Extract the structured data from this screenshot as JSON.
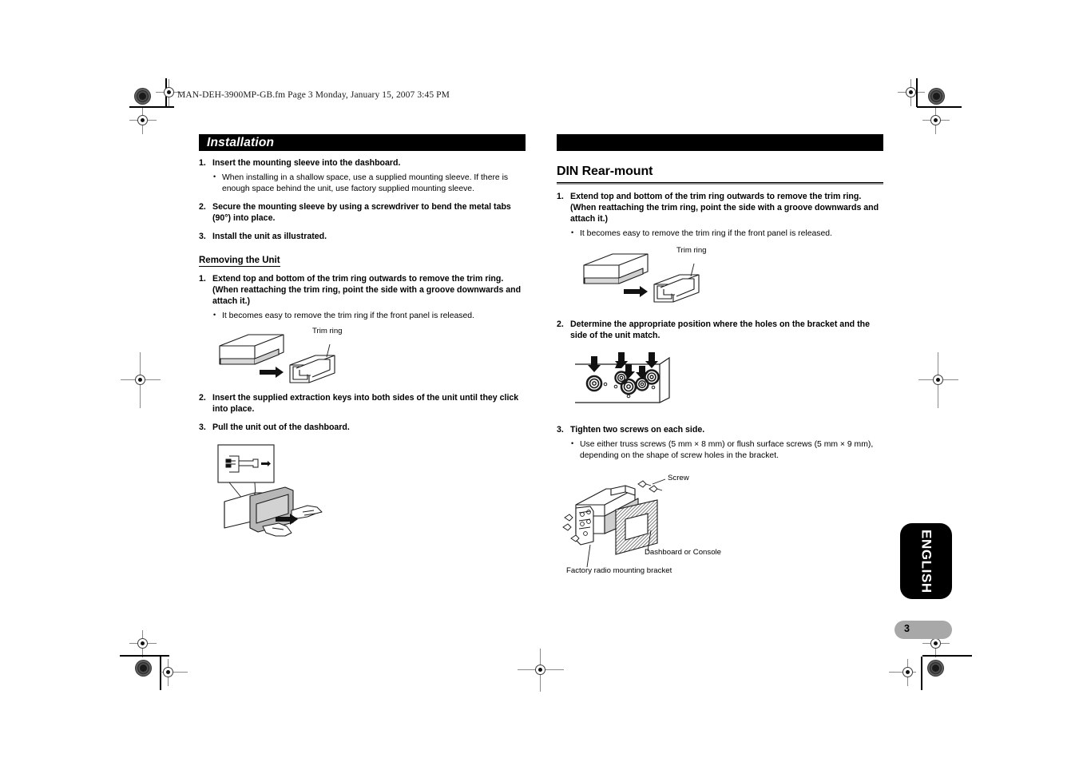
{
  "document": {
    "file_header": "MAN-DEH-3900MP-GB.fm  Page 3  Monday, January 15, 2007  3:45 PM",
    "page_number": "3",
    "language_tab": "ENGLISH"
  },
  "left_column": {
    "bar_title": "Installation",
    "steps": [
      {
        "num": "1.",
        "text": "Insert the mounting sleeve into the dashboard.",
        "bullets": [
          "When installing in a shallow space, use a supplied mounting sleeve. If there is enough space behind the unit, use factory supplied mounting sleeve."
        ]
      },
      {
        "num": "2.",
        "text": "Secure the mounting sleeve by using a screwdriver to bend the metal tabs (90°) into place.",
        "bullets": []
      },
      {
        "num": "3.",
        "text": "Install the unit as illustrated.",
        "bullets": []
      }
    ],
    "sub_head": "Removing the Unit",
    "removing_steps": [
      {
        "num": "1.",
        "text": "Extend top and bottom of the trim ring outwards to remove the trim ring. (When reattaching the trim ring, point the side with a groove downwards and attach it.)",
        "bullets": [
          "It becomes easy to remove the trim ring if the front panel is released."
        ]
      },
      {
        "num": "2.",
        "text": "Insert the supplied extraction keys into both sides of the unit until they click into place.",
        "bullets": []
      },
      {
        "num": "3.",
        "text": "Pull the unit out of the dashboard.",
        "bullets": []
      }
    ],
    "figure_trim_ring_label": "Trim ring"
  },
  "right_column": {
    "bar_title": "",
    "heading": "DIN Rear-mount",
    "steps": [
      {
        "num": "1.",
        "text": "Extend top and bottom of the trim ring outwards to remove the trim ring. (When reattaching the trim ring, point the side with a groove downwards and attach it.)",
        "bullets": [
          "It becomes easy to remove the trim ring if the front panel is released."
        ]
      },
      {
        "num": "2.",
        "text": "Determine the appropriate position where the holes on the bracket and the side of the unit match.",
        "bullets": []
      },
      {
        "num": "3.",
        "text": "Tighten two screws on each side.",
        "bullets": [
          "Use either truss screws (5 mm × 8 mm) or flush surface screws (5 mm × 9 mm), depending on the shape of screw holes in the bracket."
        ]
      }
    ],
    "figure_trim_ring_label": "Trim ring",
    "figure_screw_label": "Screw",
    "figure_dashboard_label": "Dashboard or Console",
    "figure_bracket_label": "Factory radio mounting bracket"
  }
}
